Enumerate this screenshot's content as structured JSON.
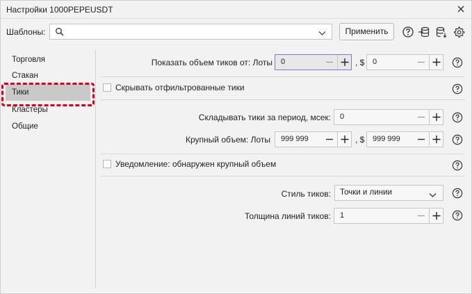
{
  "window": {
    "title": "Настройки 1000PEPEUSDT"
  },
  "templates": {
    "label": "Шаблоны:",
    "search_value": "",
    "apply_label": "Применить"
  },
  "sidebar": {
    "items": [
      {
        "label": "Торговля"
      },
      {
        "label": "Стакан"
      },
      {
        "label": "Тики",
        "active": true
      },
      {
        "label": "Кластеры"
      },
      {
        "label": "Общие"
      }
    ]
  },
  "settings": {
    "show_volume": {
      "label": "Показать объем тиков от: Лоты",
      "lots_value": "0",
      "usd_label": ", $",
      "usd_value": "0"
    },
    "hide_filtered": {
      "label": "Скрывать отфильтрованные тики",
      "checked": false
    },
    "sum_period": {
      "label": "Складывать тики за период, мсек:",
      "value": "0"
    },
    "large_volume": {
      "label": "Крупный объем: Лоты",
      "lots_value": "999 999",
      "usd_label": ", $",
      "usd_value": "999 999"
    },
    "notify_large": {
      "label": "Уведомление: обнаружен крупный объем",
      "checked": false
    },
    "tick_style": {
      "label": "Стиль тиков:",
      "value": "Точки и линии"
    },
    "line_width": {
      "label": "Толщина линий тиков:",
      "value": "1"
    }
  },
  "colors": {
    "accent_focus": "#7b78d8",
    "highlight": "#e0001a",
    "active_item": "#c9c9c9"
  }
}
